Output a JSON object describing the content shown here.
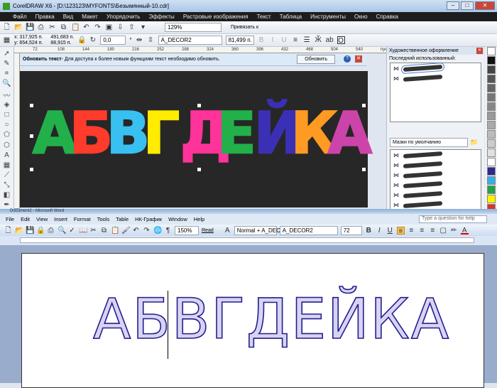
{
  "corel": {
    "title": "CorelDRAW X6 - [D:\\123123\\MYFONTS\\Безымянный-10.cdr]",
    "menu": [
      "Файл",
      "Правка",
      "Вид",
      "Макет",
      "Упорядочить",
      "Эффекты",
      "Растровые изображения",
      "Текст",
      "Таблица",
      "Инструменты",
      "Окно",
      "Справка"
    ],
    "zoom": "129%",
    "snap": "Привязать к",
    "x": "x: 317,925 п.",
    "y": "y: 654,524 п.",
    "w": "491,683 п.",
    "h": "88,915 п.",
    "angle": "0,0",
    "degree": "°",
    "font": "A_DECOR2",
    "size": "81,499 п.",
    "ruler": [
      "72",
      "108",
      "144",
      "180",
      "216",
      "252",
      "288",
      "324",
      "360",
      "396",
      "432",
      "468",
      "504",
      "540",
      "пункты"
    ],
    "notice": {
      "title": "Обновить текст",
      "text": " - Для доступа к более новым функциям текст необходимо обновить.",
      "button": "Обновить"
    },
    "canvas_text": [
      {
        "ch": "А",
        "color": "#22b04a"
      },
      {
        "ch": "Б",
        "color": "#ff3b2b"
      },
      {
        "ch": "В",
        "color": "#38c0f0"
      },
      {
        "ch": "Г",
        "color": "#ffec00"
      },
      {
        "ch": "Д",
        "color": "#ff3399"
      },
      {
        "ch": "Е",
        "color": "#22b04a"
      },
      {
        "ch": "Й",
        "color": "#3b30b5"
      },
      {
        "ch": "К",
        "color": "#ff9a22"
      },
      {
        "ch": "А",
        "color": "#cc44aa"
      }
    ],
    "docker": {
      "title": "Художественное оформление",
      "recent": "Последний использованный:",
      "preset": "Мазки по умолчанию"
    },
    "palette": [
      "#ffffff",
      "#111111",
      "#444444",
      "#555555",
      "#666666",
      "#777777",
      "#888888",
      "#999999",
      "#aaaaaa",
      "#bbbbbb",
      "#cccccc",
      "#e0e0e0",
      "#ffffff",
      "#2e2a8c",
      "#39aee6",
      "#22a04a",
      "#fff200",
      "#d8342a",
      "#cc3a8a",
      "#a04090",
      "#e8862a",
      "#f0b0b0"
    ]
  },
  "word": {
    "title": "Document2 - Microsoft Word",
    "menu": [
      "File",
      "Edit",
      "View",
      "Insert",
      "Format",
      "Tools",
      "Table",
      "НК-График",
      "Window",
      "Help"
    ],
    "help": "Type a question for help",
    "zoom": "150%",
    "read": "Read",
    "style": "Normal + A_DECOI",
    "font": "A_DECOR2",
    "size": "72",
    "bold": "B",
    "italic": "I",
    "underline": "U",
    "text": "АБВГДЕЙКА"
  }
}
